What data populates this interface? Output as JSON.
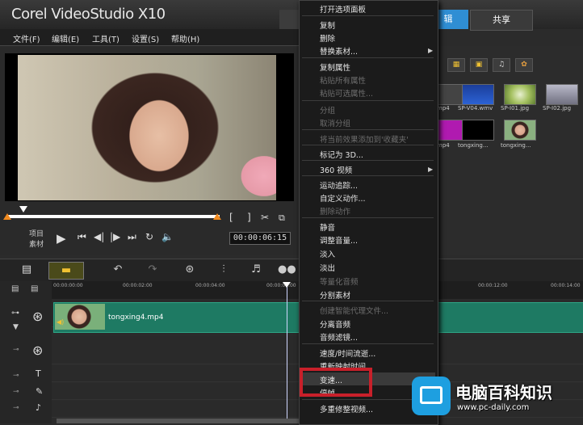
{
  "app": {
    "title": "Corel VideoStudio X10"
  },
  "top_tabs": {
    "capture": "",
    "edit": "编辑",
    "edit_visible": "辑",
    "share": "共享"
  },
  "menubar": [
    "文件(F)",
    "编辑(E)",
    "工具(T)",
    "设置(S)",
    "帮助(H)"
  ],
  "preview": {
    "mode_labels": [
      "项目",
      "素材"
    ],
    "timecode": "00:00:06:15",
    "controls": [
      "play",
      "start",
      "prev-frame",
      "next-frame",
      "end",
      "repeat",
      "volume"
    ]
  },
  "library": {
    "thumbs": [
      {
        "label": "mp4"
      },
      {
        "label": "SP-V04.wmv"
      },
      {
        "label": "SP-I01.jpg"
      },
      {
        "label": "SP-I02.jpg"
      },
      {
        "label": "mp4"
      },
      {
        "label": "tongxing..."
      },
      {
        "label": "tongxing..."
      }
    ]
  },
  "timeline": {
    "ruler": [
      "00:00:00:00",
      "00:00:02:00",
      "00:00:04:00",
      "00:00:06:00",
      "00:00:12:00",
      "00:00:14:00"
    ],
    "clip_label": "tongxing4.mp4"
  },
  "context_menu": {
    "items": [
      {
        "label": "打开选项面板",
        "enabled": true
      },
      {
        "label": "复制",
        "enabled": true
      },
      {
        "label": "删除",
        "enabled": true
      },
      {
        "label": "替换素材...",
        "enabled": true,
        "submenu": true
      },
      {
        "label": "复制属性",
        "enabled": true
      },
      {
        "label": "粘贴所有属性",
        "enabled": false
      },
      {
        "label": "粘贴可选属性...",
        "enabled": false
      },
      {
        "label": "分组",
        "enabled": false
      },
      {
        "label": "取消分组",
        "enabled": false
      },
      {
        "label": "将当前效果添加到'收藏夹'",
        "enabled": false
      },
      {
        "label": "标记为 3D...",
        "enabled": true
      },
      {
        "label": "360 视频",
        "enabled": true,
        "submenu": true
      },
      {
        "label": "运动追踪...",
        "enabled": true
      },
      {
        "label": "自定义动作...",
        "enabled": true
      },
      {
        "label": "删除动作",
        "enabled": false
      },
      {
        "label": "静音",
        "enabled": true
      },
      {
        "label": "调整音量...",
        "enabled": true
      },
      {
        "label": "淡入",
        "enabled": true
      },
      {
        "label": "淡出",
        "enabled": true
      },
      {
        "label": "等量化音频",
        "enabled": false
      },
      {
        "label": "分割素材",
        "enabled": true
      },
      {
        "label": "创建智能代理文件...",
        "enabled": false
      },
      {
        "label": "分离音频",
        "enabled": true
      },
      {
        "label": "音频滤镜...",
        "enabled": true
      },
      {
        "label": "速度/时间流逝...",
        "enabled": true
      },
      {
        "label": "重新映射时间",
        "enabled": true
      },
      {
        "label": "变速...",
        "enabled": true,
        "highlighted": true
      },
      {
        "label": "停帧",
        "enabled": true
      },
      {
        "label": "多重修整视频...",
        "enabled": true
      }
    ]
  },
  "watermark": {
    "title": "电脑百科知识",
    "url": "www.pc-daily.com"
  },
  "colors": {
    "accent": "#2f8ed4",
    "clip": "#1e7a63",
    "highlight_box": "#c8202a",
    "scrub_marker": "#f08a1f"
  }
}
